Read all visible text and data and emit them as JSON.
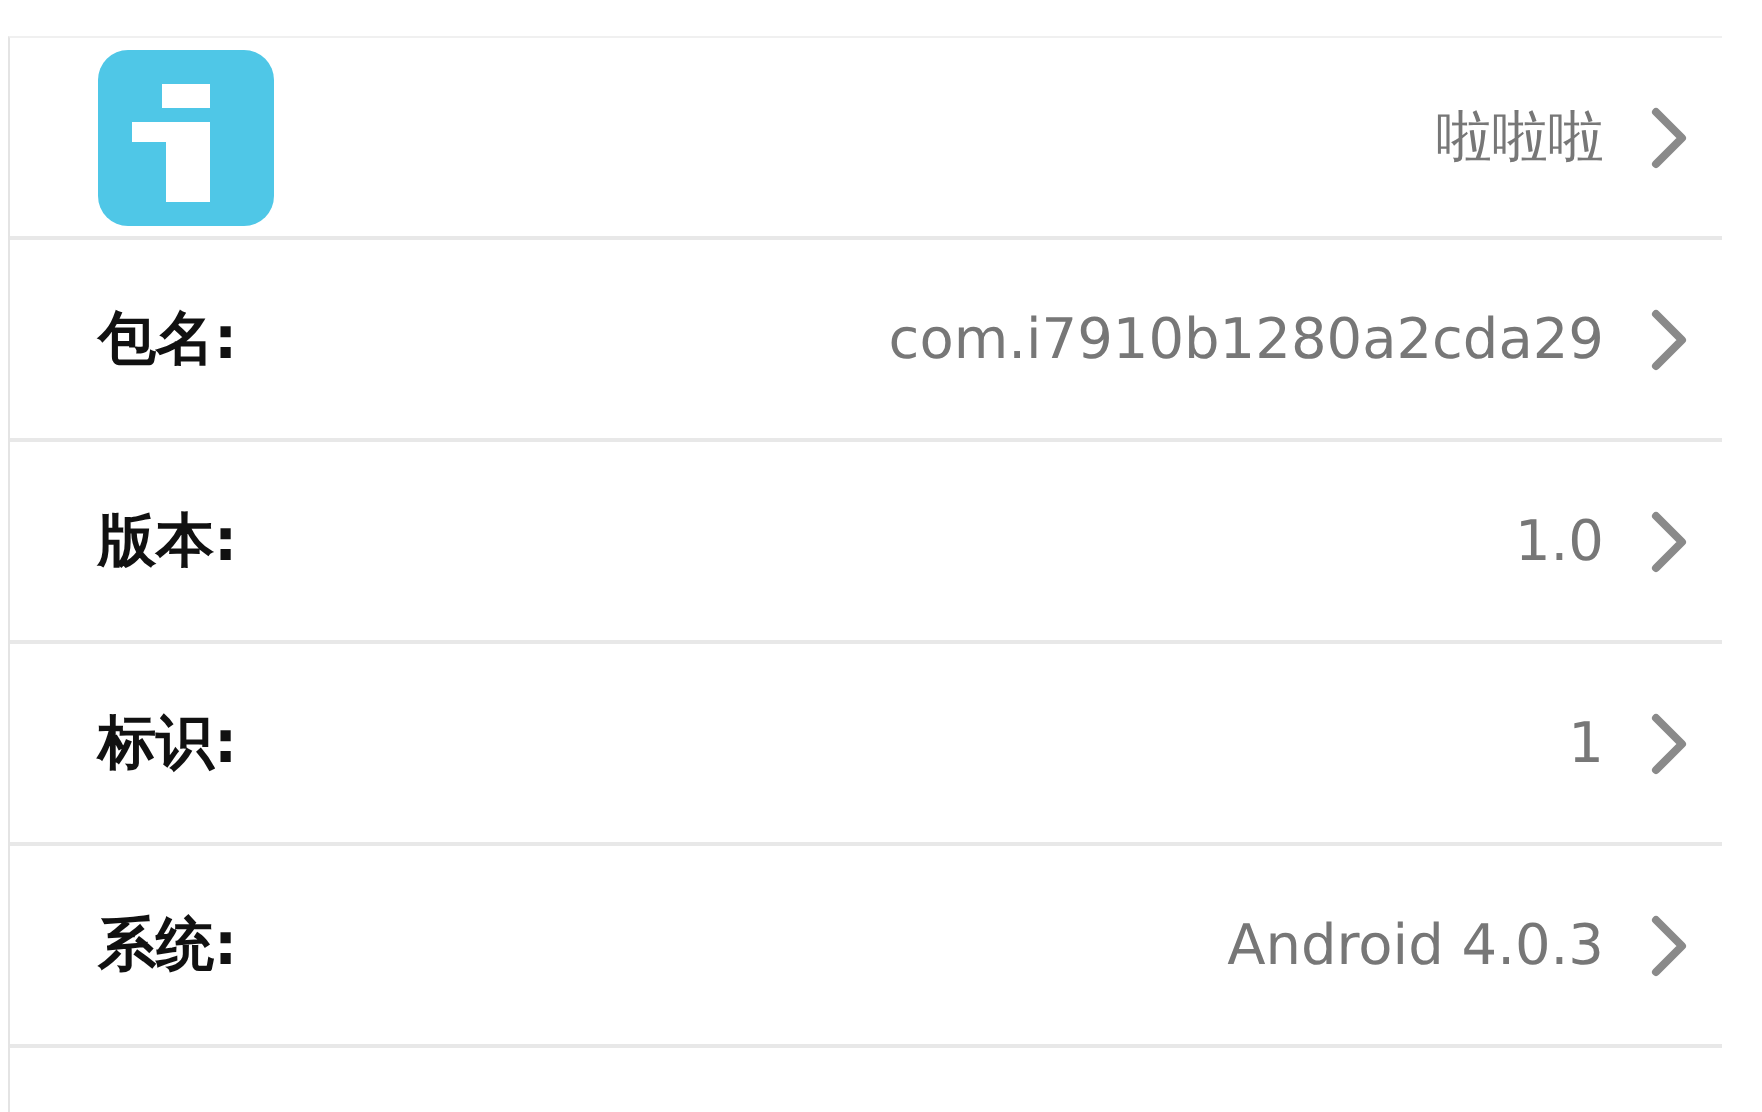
{
  "header": {
    "value": "啦啦啦"
  },
  "rows": [
    {
      "label": "包名:",
      "value": "com.i7910b1280a2cda29"
    },
    {
      "label": "版本:",
      "value": "1.0"
    },
    {
      "label": "标识:",
      "value": "1"
    },
    {
      "label": "系统:",
      "value": "Android 4.0.3"
    }
  ]
}
